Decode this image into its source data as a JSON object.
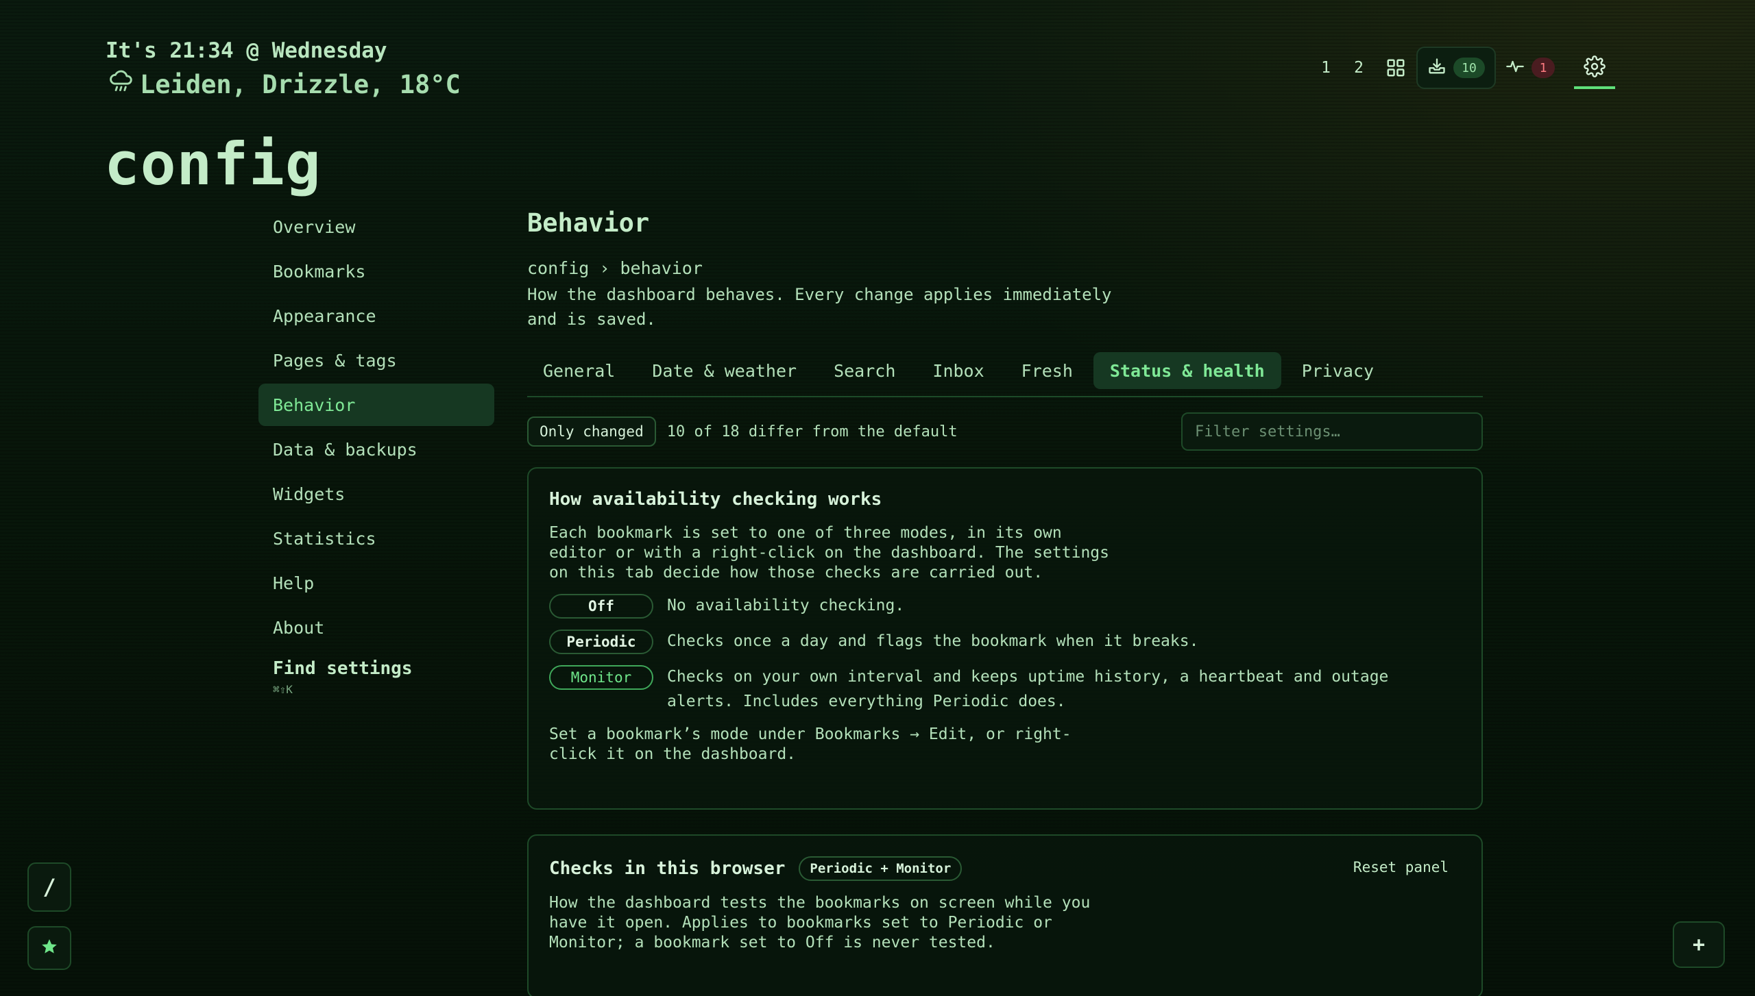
{
  "header": {
    "time_line": "It's 21:34 @ Wednesday",
    "weather_line": "Leiden, Drizzle, 18°C",
    "weather_icon": "cloud-drizzle-icon",
    "page_title": "config"
  },
  "toolbar": {
    "page_1": "1",
    "page_2": "2",
    "inbox_count": "10",
    "health_count": "1",
    "icons": [
      "grid-icon",
      "inbox-download-icon",
      "pulse-icon",
      "gear-icon"
    ]
  },
  "sidebar": {
    "items": [
      {
        "label": "Overview"
      },
      {
        "label": "Bookmarks"
      },
      {
        "label": "Appearance"
      },
      {
        "label": "Pages & tags"
      },
      {
        "label": "Behavior"
      },
      {
        "label": "Data & backups"
      },
      {
        "label": "Widgets"
      },
      {
        "label": "Statistics"
      },
      {
        "label": "Help"
      },
      {
        "label": "About"
      }
    ],
    "active": "Behavior",
    "find_settings": "Find settings",
    "find_shortcut": "⌘⇧K"
  },
  "main": {
    "title": "Behavior",
    "breadcrumb": "config › behavior",
    "description": "How the dashboard behaves. Every change applies immediately and is saved.",
    "tabs": [
      {
        "label": "General"
      },
      {
        "label": "Date & weather"
      },
      {
        "label": "Search"
      },
      {
        "label": "Inbox"
      },
      {
        "label": "Fresh"
      },
      {
        "label": "Status & health"
      },
      {
        "label": "Privacy"
      }
    ],
    "active_tab": "Status & health",
    "only_changed_label": "Only changed",
    "diff_summary": "10 of 18 differ from the default",
    "filter_placeholder": "Filter settings…"
  },
  "panel_availability": {
    "title": "How availability checking works",
    "intro": "Each bookmark is set to one of three modes, in its own editor or with a right-click on the dashboard. The settings on this tab decide how those checks are carried out.",
    "modes": [
      {
        "name": "Off",
        "desc": "No availability checking."
      },
      {
        "name": "Periodic",
        "desc": "Checks once a day and flags the bookmark when it breaks."
      },
      {
        "name": "Monitor",
        "desc": "Checks on your own interval and keeps uptime history, a heartbeat and outage alerts. Includes everything Periodic does."
      }
    ],
    "footer": "Set a bookmark’s mode under Bookmarks → Edit, or right-click it on the dashboard."
  },
  "panel_checks": {
    "title": "Checks in this browser",
    "badge": "Periodic + Monitor",
    "reset_label": "Reset panel",
    "text": "How the dashboard tests the bookmarks on screen while you have it open. Applies to bookmarks set to Periodic or Monitor; a bookmark set to Off is never tested."
  },
  "floating": {
    "slash_label": "/",
    "plus_label": "+",
    "star_icon": "star-icon"
  },
  "colors": {
    "accent": "#5fe07a",
    "background": "#061208",
    "text": "#b3e0b9",
    "alert": "#ff7b80"
  }
}
